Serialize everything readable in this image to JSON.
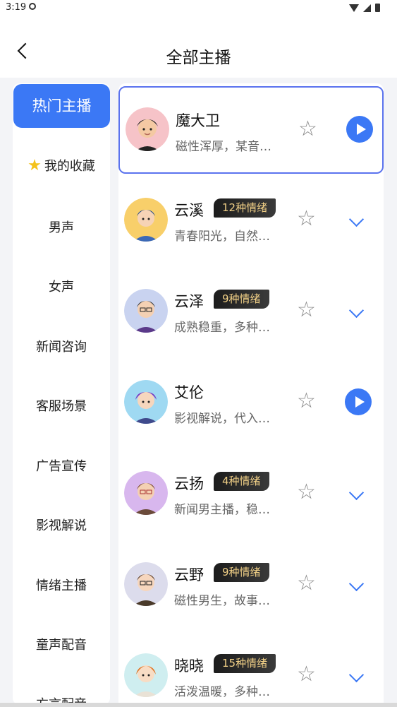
{
  "status": {
    "time": "3:19"
  },
  "header": {
    "title": "全部主播"
  },
  "sidebar": {
    "items": [
      {
        "label": "热门主播",
        "active": true
      },
      {
        "label": "我的收藏",
        "icon": "star-emoji"
      },
      {
        "label": "男声"
      },
      {
        "label": "女声"
      },
      {
        "label": "新闻咨询"
      },
      {
        "label": "客服场景"
      },
      {
        "label": "广告宣传"
      },
      {
        "label": "影视解说"
      },
      {
        "label": "情绪主播"
      },
      {
        "label": "童声配音"
      },
      {
        "label": "方言配音"
      }
    ]
  },
  "voices": [
    {
      "name": "魔大卫",
      "tag": "",
      "desc": "磁性浑厚，某音…",
      "action": "play",
      "selected": true
    },
    {
      "name": "云溪",
      "tag": "12种情绪",
      "desc": "青春阳光，自然…",
      "action": "expand"
    },
    {
      "name": "云泽",
      "tag": "9种情绪",
      "desc": "成熟稳重，多种…",
      "action": "expand"
    },
    {
      "name": "艾伦",
      "tag": "",
      "desc": "影视解说，代入…",
      "action": "play"
    },
    {
      "name": "云扬",
      "tag": "4种情绪",
      "desc": "新闻男主播，稳…",
      "action": "expand"
    },
    {
      "name": "云野",
      "tag": "9种情绪",
      "desc": "磁性男生，故事…",
      "action": "expand"
    },
    {
      "name": "晓晓",
      "tag": "15种情绪",
      "desc": "活泼温暖，多种…",
      "action": "expand"
    }
  ],
  "colors": {
    "accent": "#3b78f5",
    "tag_text": "#f0cf86"
  }
}
